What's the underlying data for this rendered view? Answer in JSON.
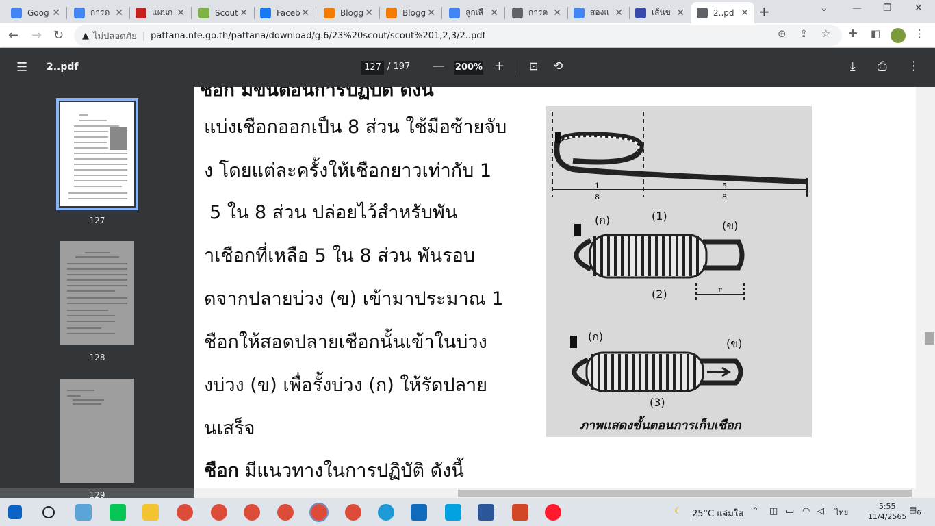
{
  "tabs": [
    {
      "title": "Goog",
      "icon": "google-icon",
      "color": "#4285f4"
    },
    {
      "title": "การต",
      "icon": "docs-icon",
      "color": "#4285f4"
    },
    {
      "title": "แผนก",
      "icon": "red-rose-icon",
      "color": "#c5221f"
    },
    {
      "title": "Scout",
      "icon": "scout-icon",
      "color": "#7cb342"
    },
    {
      "title": "Faceb",
      "icon": "facebook-icon",
      "color": "#1877f2"
    },
    {
      "title": "Blogg",
      "icon": "blogger-icon",
      "color": "#f57c00"
    },
    {
      "title": "Blogg",
      "icon": "blogger-icon",
      "color": "#f57c00"
    },
    {
      "title": "ลูกเสื",
      "icon": "google-icon",
      "color": "#4285f4"
    },
    {
      "title": "การต",
      "icon": "globe-icon",
      "color": "#5f6368"
    },
    {
      "title": "สองแ",
      "icon": "google-icon",
      "color": "#4285f4"
    },
    {
      "title": "เส้นข",
      "icon": "site-icon",
      "color": "#3949ab"
    },
    {
      "title": "2..pd",
      "icon": "globe-icon",
      "color": "#5f6368",
      "active": true
    }
  ],
  "address": {
    "insecure_label": "ไม่ปลอดภัย",
    "url": "pattana.nfe.go.th/pattana/download/g.6/23%20scout/scout%201,2,3/2..pdf"
  },
  "pdf": {
    "filename": "2..pdf",
    "page": "127",
    "total": "/ 197",
    "zoom": "200%"
  },
  "thumbnails": [
    "127",
    "128",
    "129"
  ],
  "page_text": [
    "แบ่งเชือกออกเป็น 8 ส่วน ใช้มือซ้ายจับ",
    "ง โดยแต่ละครั้งให้เชือกยาวเท่ากับ 1",
    "5 ใน 8 ส่วน ปล่อยไว้สำหรับพัน",
    "าเชือกที่เหลือ 5 ใน 8 ส่วน พันรอบ",
    "ดจากปลายบ่วง (ข) เข้ามาประมาณ 1",
    "ชือกให้สอดปลายเชือกนั้นเข้าในบ่วง",
    "งบ่วง (ข) เพื่อรั้งบ่วง (ก) ให้รัดปลาย",
    "นเสร็จ"
  ],
  "bottom_text_bold": "ชือก",
  "bottom_text_rest": " มีแนวทางในการปฏิบัติ ดังนี้",
  "figure": {
    "caption": "ภาพแสดงขั้นตอนการเก็บเชือก",
    "label_1": "(1)",
    "label_2": "(2)",
    "label_3": "(3)",
    "label_ko": "(ก)",
    "label_kho": "(ข)",
    "frac_left_num": "1",
    "frac_left_den": "8",
    "frac_right_num": "5",
    "frac_right_den": "8",
    "r_label": "r"
  },
  "taskbar": {
    "weather": "25°C แจ่มใส",
    "lang": "ไทย",
    "time": "5:55",
    "date": "11/4/2565",
    "notif_count": "6"
  }
}
